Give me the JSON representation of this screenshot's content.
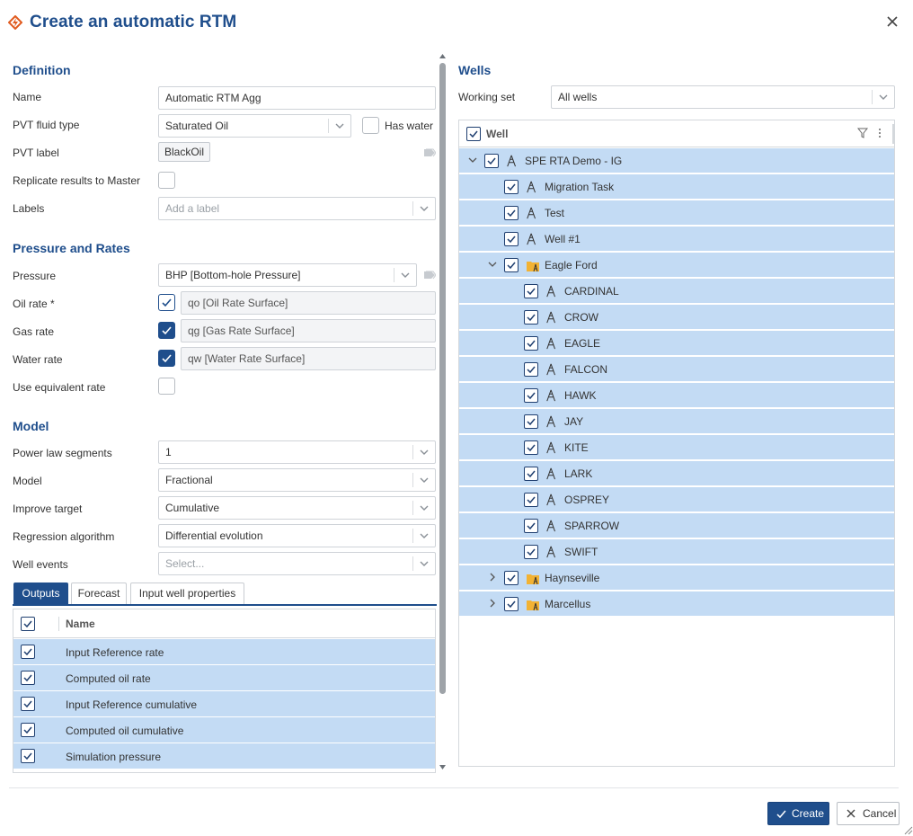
{
  "dialog": {
    "title": "Create an automatic RTM"
  },
  "definition": {
    "section_title": "Definition",
    "name_label": "Name",
    "name_value": "Automatic RTM Agg",
    "pvt_fluid_label": "PVT fluid type",
    "pvt_fluid_value": "Saturated Oil",
    "has_water_label": "Has water",
    "has_water_checked": false,
    "pvt_label_label": "PVT label",
    "pvt_label_value": "BlackOil",
    "replicate_label": "Replicate results to Master",
    "replicate_checked": false,
    "labels_label": "Labels",
    "labels_placeholder": "Add a label"
  },
  "pressure_rates": {
    "section_title": "Pressure and Rates",
    "pressure_label": "Pressure",
    "pressure_value": "BHP [Bottom-hole Pressure]",
    "oil_rate_label": "Oil rate *",
    "oil_rate_value": "qo [Oil Rate Surface]",
    "oil_rate_checked": true,
    "gas_rate_label": "Gas rate",
    "gas_rate_value": "qg [Gas Rate Surface]",
    "gas_rate_checked": true,
    "water_rate_label": "Water rate",
    "water_rate_value": "qw [Water Rate Surface]",
    "water_rate_checked": true,
    "equiv_rate_label": "Use equivalent rate",
    "equiv_rate_checked": false
  },
  "model": {
    "section_title": "Model",
    "power_law_label": "Power law segments",
    "power_law_value": "1",
    "model_label": "Model",
    "model_value": "Fractional",
    "improve_label": "Improve target",
    "improve_value": "Cumulative",
    "regression_label": "Regression algorithm",
    "regression_value": "Differential evolution",
    "well_events_label": "Well events",
    "well_events_placeholder": "Select..."
  },
  "tabs": [
    {
      "label": "Outputs",
      "active": true
    },
    {
      "label": "Forecast",
      "active": false
    },
    {
      "label": "Input well properties",
      "active": false
    }
  ],
  "outputs": {
    "column_name": "Name",
    "rows": [
      {
        "label": "Input Reference rate",
        "checked": true
      },
      {
        "label": "Computed oil rate",
        "checked": true
      },
      {
        "label": "Input Reference cumulative",
        "checked": true
      },
      {
        "label": "Computed oil cumulative",
        "checked": true
      },
      {
        "label": "Simulation pressure",
        "checked": true
      }
    ]
  },
  "wells": {
    "section_title": "Wells",
    "working_set_label": "Working set",
    "working_set_value": "All wells",
    "column_name": "Well",
    "rows": [
      {
        "label": "SPE RTA Demo - IG",
        "icon": "derrick-icon",
        "expander": "down"
      },
      {
        "label": "Migration Task",
        "icon": "derrick-icon"
      },
      {
        "label": "Test",
        "icon": "derrick-icon"
      },
      {
        "label": "Well #1",
        "icon": "derrick-icon"
      },
      {
        "label": "Eagle Ford",
        "icon": "folder-well-icon",
        "expander": "down"
      },
      {
        "label": "CARDINAL",
        "icon": "derrick-icon"
      },
      {
        "label": "CROW",
        "icon": "derrick-icon"
      },
      {
        "label": "EAGLE",
        "icon": "derrick-icon"
      },
      {
        "label": "FALCON",
        "icon": "derrick-icon"
      },
      {
        "label": "HAWK",
        "icon": "derrick-icon"
      },
      {
        "label": "JAY",
        "icon": "derrick-icon"
      },
      {
        "label": "KITE",
        "icon": "derrick-icon"
      },
      {
        "label": "LARK",
        "icon": "derrick-icon"
      },
      {
        "label": "OSPREY",
        "icon": "derrick-icon"
      },
      {
        "label": "SPARROW",
        "icon": "derrick-icon"
      },
      {
        "label": "SWIFT",
        "icon": "derrick-icon"
      },
      {
        "label": "Haynseville",
        "icon": "folder-well-icon",
        "expander": "right"
      },
      {
        "label": "Marcellus",
        "icon": "folder-well-icon",
        "expander": "right"
      }
    ]
  },
  "footer": {
    "create_label": "Create",
    "cancel_label": "Cancel"
  },
  "colors": {
    "accent": "#1f4e8c",
    "selection": "#c3dbf4",
    "folder": "#f2b233"
  }
}
